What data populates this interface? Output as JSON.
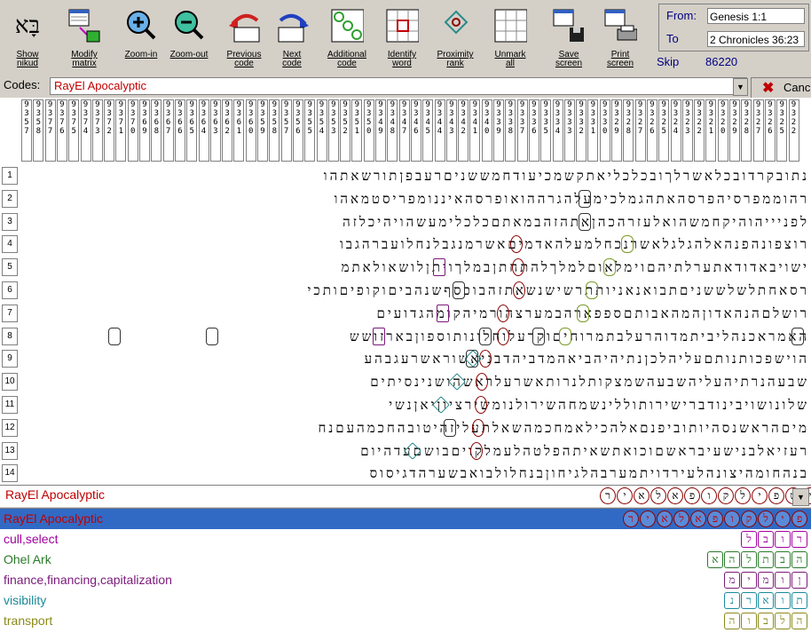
{
  "toolbar": {
    "buttons": [
      {
        "label": "Show\nnikud",
        "icon": "nikud-icon"
      },
      {
        "label": "Modify\nmatrix",
        "icon": "matrix-icon"
      },
      {
        "label": "Zoom-in",
        "icon": "zoom-in-icon"
      },
      {
        "label": "Zoom-out",
        "icon": "zoom-out-icon"
      },
      {
        "label": "Previous\ncode",
        "icon": "previous-code-icon"
      },
      {
        "label": "Next\ncode",
        "icon": "next-code-icon"
      },
      {
        "label": "Additional\ncode",
        "icon": "additional-code-icon"
      },
      {
        "label": "Identify\nword",
        "icon": "identify-word-icon"
      },
      {
        "label": "Proximity\nrank",
        "icon": "proximity-rank-icon"
      },
      {
        "label": "Unmark\nall",
        "icon": "unmark-all-icon"
      },
      {
        "label": "Save\nscreen",
        "icon": "save-screen-icon"
      },
      {
        "label": "Print\nscreen",
        "icon": "print-screen-icon"
      }
    ],
    "nikud_glyph": "בָּא"
  },
  "range": {
    "from_label": "From:",
    "to_label": "To",
    "from_value": "Genesis 1:1",
    "to_value": "2 Chronicles 36:23"
  },
  "skip": {
    "label": "Skip",
    "value": "86220"
  },
  "codes": {
    "label": "Codes:",
    "value": "RayEl Apocalyptic",
    "cancel_label": "Canc"
  },
  "column_numbers": [
    "9357",
    "9358",
    "9377",
    "9376",
    "9375",
    "9374",
    "9373",
    "9372",
    "9371",
    "9370",
    "9369",
    "9368",
    "9367",
    "9366",
    "9365",
    "9364",
    "9363",
    "9362",
    "9361",
    "9360",
    "9359",
    "9358",
    "9357",
    "9356",
    "9355",
    "9354",
    "9353",
    "9352",
    "9351",
    "9350",
    "9349",
    "9348",
    "9347",
    "9346",
    "9345",
    "9344",
    "9343",
    "9342",
    "9341",
    "9340",
    "9339",
    "9338",
    "9337",
    "9336",
    "9335",
    "9334",
    "9333",
    "9332",
    "9331",
    "9330",
    "9329",
    "9328",
    "9327",
    "9326",
    "9325",
    "9324",
    "9323",
    "9322",
    "9321",
    "9320",
    "9329",
    "9328",
    "9327",
    "9326",
    "9325",
    "9322"
  ],
  "rows": [
    {
      "num": "1",
      "text": "נתובקרדובכלאשרלךובכלכליאתקשמכיעודחמששניםרעבפןתורשאתהו"
    },
    {
      "num": "2",
      "text": "רהוממפרסיהפרסהאתהגמלכימעלהגרההואופרסהאיננומפריסטמאהו"
    },
    {
      "num": "3",
      "text": "לפניייהוהיקחמשהואלעזרהכהןאתהזהבמאתםכלכלימעשהויהיכלזה"
    },
    {
      "num": "4",
      "text": "רוצפונהפנהאלהגלגלאשרנכחלמעלהאדמיםאשרמנגבלנחלועברהגבו"
    },
    {
      "num": "5",
      "text": "ישויבאדודאתערלתיהםוימלאוםלמלךלהתחתןבמלךויתןלושאולאתמ"
    },
    {
      "num": "6",
      "text": "רסאחתלשלששניםתבואנאניותתרשישנשאתזהבוכסףשנהביםוקופיםותכי"
    },
    {
      "num": "7",
      "text": "רושלםהנהאדוןהמהאבותםספפארהבמערצהורמיהקומהגדועים"
    },
    {
      "num": "8",
      "text": "האמראכנהליביתמדוהרעלבתמרוחיםוקרעלוחלונותוספוןבארזושש"
    },
    {
      "num": "9",
      "text": "הוישפכותנותםעליהלכןנתיהיהביאהמדביהדבניאשוראשרעגבהע"
    },
    {
      "num": "10",
      "text": "שבעהנרתיהעליהשבעהשמצקותלנרותאשרעלראשהושנינסיתים"
    },
    {
      "num": "11",
      "text": "שלונושויבינודברישירותוללינשמחהשירולנומשירציוןיאןנשי"
    },
    {
      "num": "12",
      "text": "מיםהראשנסהיותוביפנםאלהכילאמחכמהשאלתעליזהיטובהחכמהעםנח"
    },
    {
      "num": "13",
      "text": "רעזיאלבנישעיבראשםוכואתשאיתהפלטהלעמלקויםבושםעדהיום"
    },
    {
      "num": "14",
      "text": "בנהחומהיצונהלעירדויתמערבהלגיחוןבנחלולבואבשערהדגיסוס"
    }
  ],
  "term_bar": {
    "label": "RayEl Apocalyptic",
    "letters": [
      "ר",
      "י",
      "א",
      "ל",
      "א",
      "פ",
      "ו",
      "ק",
      "ל",
      "י",
      "פ",
      "ט",
      "י"
    ]
  },
  "terms": [
    {
      "label": "RayEl Apocalyptic",
      "color": "#c00000",
      "selected": true,
      "letters": [
        "ר",
        "י",
        "א",
        "ל",
        "א",
        "פ",
        "ו",
        "ק",
        "ל",
        "י",
        "פ"
      ]
    },
    {
      "label": "cull,select",
      "color": "#a000a0",
      "selected": false,
      "letters": [
        "ל",
        "ב",
        "ו",
        "ר"
      ]
    },
    {
      "label": "Ohel Ark",
      "color": "#2a7a2a",
      "selected": false,
      "letters": [
        "א",
        "ה",
        "ל",
        "ת",
        "ב",
        "ה"
      ]
    },
    {
      "label": "finance,financing,capitalization",
      "color": "#7a1a7a",
      "selected": false,
      "letters": [
        "מ",
        "י",
        "מ",
        "ו",
        "ן"
      ]
    },
    {
      "label": "visibility",
      "color": "#1a8a9a",
      "selected": false,
      "letters": [
        "נ",
        "ר",
        "א",
        "ו",
        "ת"
      ]
    },
    {
      "label": "transport",
      "color": "#8a8a1a",
      "selected": false,
      "letters": [
        "ה",
        "ו",
        "ב",
        "ל",
        "ה"
      ]
    }
  ],
  "colors": {
    "accent_red": "#c00000",
    "selection_blue": "#316ac5",
    "window_bg": "#d4d0c8"
  }
}
